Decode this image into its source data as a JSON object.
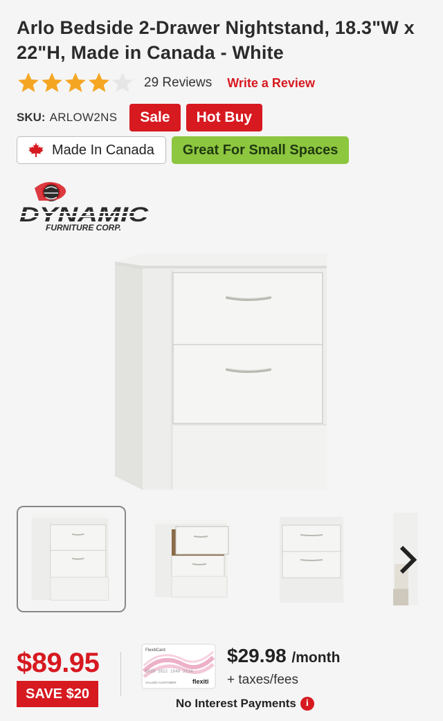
{
  "product": {
    "title": "Arlo Bedside 2-Drawer Nightstand, 18.3\"W x 22\"H, Made in Canada - White",
    "rating": 4,
    "rating_max": 5,
    "reviews_label": "29 Reviews",
    "write_review_label": "Write a Review",
    "sku_label": "SKU:",
    "sku_value": "ARLOW2NS"
  },
  "badges": {
    "sale": "Sale",
    "hot_buy": "Hot Buy",
    "made_in_canada": "Made In Canada",
    "small_spaces": "Great For Small Spaces"
  },
  "brand": {
    "logo_text": "DYNAMIC",
    "logo_subtext": "FURNITURE CORP."
  },
  "gallery": {
    "selected_index": 0,
    "thumbnail_count": 4
  },
  "pricing": {
    "price": "$89.95",
    "save_label": "SAVE $20",
    "monthly_amount": "$29.98",
    "monthly_unit": "/month",
    "taxes_label": "+ taxes/fees",
    "no_interest_label": "No Interest Payments",
    "card_brand": "flexiti",
    "card_header": "FlexitiCard",
    "card_number": "5020 3822 1840 2214",
    "card_holder": "VALUED CUSTOMER"
  },
  "colors": {
    "accent_red": "#d71920",
    "star_gold": "#f5a623",
    "green": "#8dc63f"
  }
}
